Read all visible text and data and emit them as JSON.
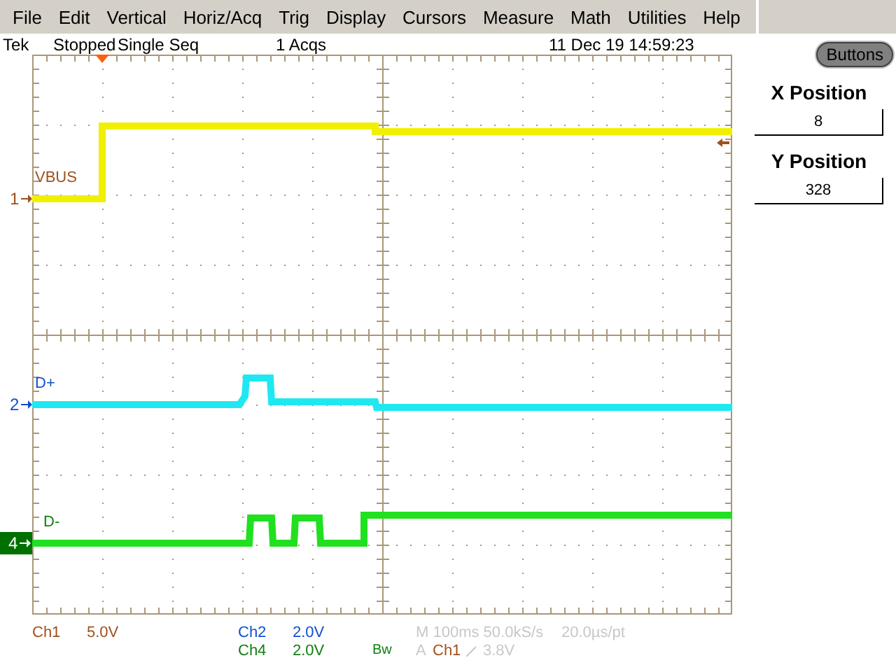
{
  "menu": [
    {
      "label": "File"
    },
    {
      "label": "Edit"
    },
    {
      "label": "Vertical"
    },
    {
      "label": "Horiz/Acq"
    },
    {
      "label": "Trig"
    },
    {
      "label": "Display"
    },
    {
      "label": "Cursors"
    },
    {
      "label": "Measure"
    },
    {
      "label": "Math"
    },
    {
      "label": "Utilities"
    },
    {
      "label": "Help"
    }
  ],
  "status": {
    "brand": "Tek",
    "run_state": "Stopped",
    "mode": "Single Seq",
    "acquisitions": "1 Acqs",
    "datetime": "11 Dec 19 14:59:23"
  },
  "traces": [
    {
      "label": "VBUS",
      "marker": "1",
      "color": "#f0f000",
      "selected": false
    },
    {
      "label": "D+",
      "marker": "2",
      "color": "#20e8f0",
      "selected": false
    },
    {
      "label": "D-",
      "marker": "4",
      "color": "#20e020",
      "selected": true
    }
  ],
  "readouts": {
    "ch1": {
      "name": "Ch1",
      "scale": "5.0V"
    },
    "ch2": {
      "name": "Ch2",
      "scale": "2.0V"
    },
    "ch4": {
      "name": "Ch4",
      "scale": "2.0V"
    },
    "bandwidth": "Bw",
    "timebase": "M 100ms 50.0kS/s",
    "resolution": "20.0µs/pt",
    "trigger": {
      "mode": "A",
      "source": "Ch1",
      "level": "3.8V"
    }
  },
  "panel": {
    "button": "Buttons",
    "fields": [
      {
        "label": "X Position",
        "value": "8"
      },
      {
        "label": "Y Position",
        "value": "328"
      }
    ]
  }
}
